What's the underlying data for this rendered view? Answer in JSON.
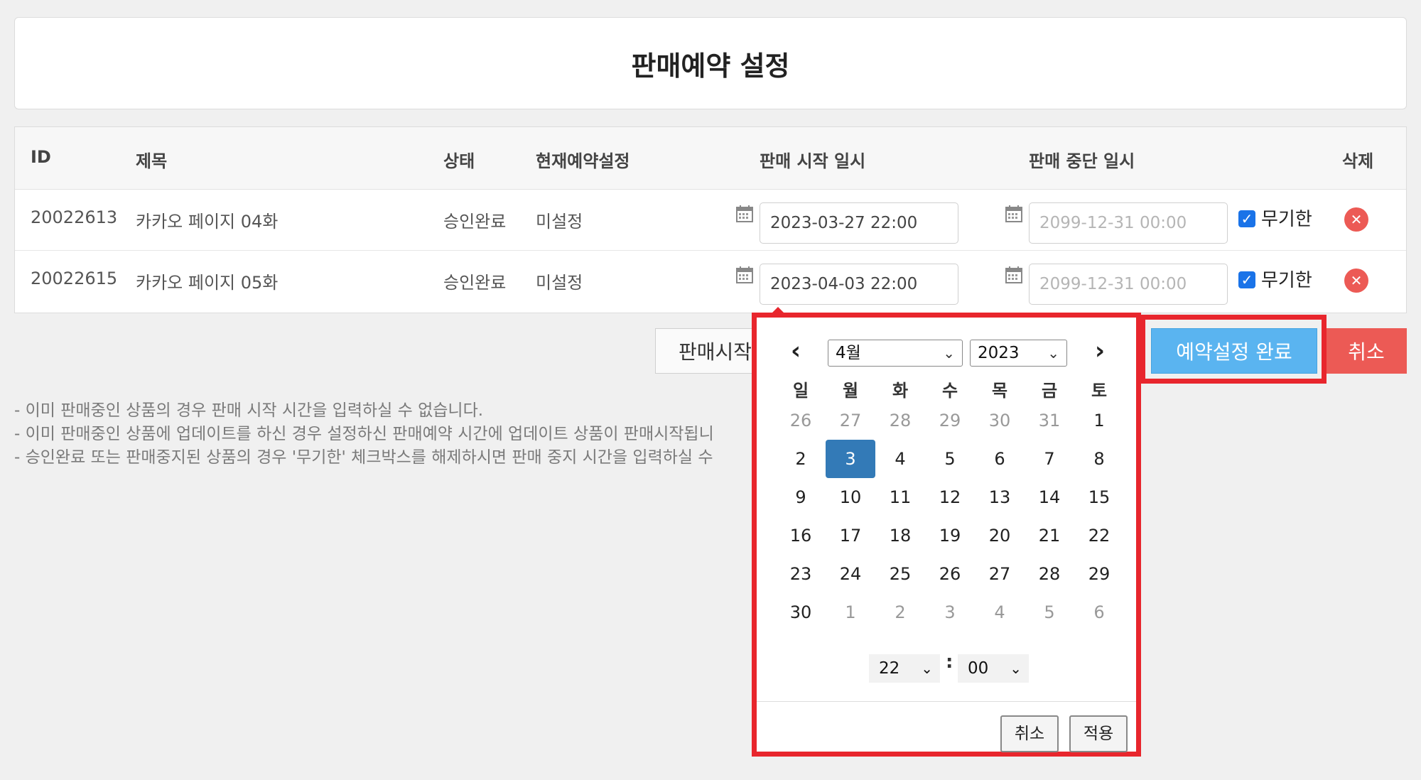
{
  "page": {
    "title": "판매예약 설정"
  },
  "table": {
    "headers": {
      "id": "ID",
      "title": "제목",
      "status": "상태",
      "current": "현재예약설정",
      "start": "판매 시작 일시",
      "stop": "판매 중단 일시",
      "delete": "삭제"
    },
    "rows": [
      {
        "id": "20022613",
        "title": "카카오 페이지 04화",
        "status": "승인완료",
        "current": "미설정",
        "start": "2023-03-27 22:00",
        "stop": "2099-12-31 00:00",
        "unlimited_label": "무기한",
        "unlimited_checked": true
      },
      {
        "id": "20022615",
        "title": "카카오 페이지 05화",
        "status": "승인완료",
        "current": "미설정",
        "start": "2023-04-03 22:00",
        "stop": "2099-12-31 00:00",
        "unlimited_label": "무기한",
        "unlimited_checked": true
      }
    ]
  },
  "buttons": {
    "start_sale": "판매시작",
    "complete": "예약설정 완료",
    "cancel": "취소"
  },
  "notes": [
    "- 이미 판매중인 상품의 경우 판매 시작 시간을 입력하실 수 없습니다.",
    "- 이미 판매중인 상품에 업데이트를 하신 경우 설정하신 판매예약 시간에 업데이트 상품이 판매시작됩니",
    "- 승인완료 또는 판매중지된 상품의 경우 '무기한' 체크박스를 해제하시면 판매 중지 시간을 입력하실 수"
  ],
  "datepicker": {
    "month": "4월",
    "year": "2023",
    "weekdays": [
      "일",
      "월",
      "화",
      "수",
      "목",
      "금",
      "토"
    ],
    "weeks": [
      [
        "26",
        "27",
        "28",
        "29",
        "30",
        "31",
        "1"
      ],
      [
        "2",
        "3",
        "4",
        "5",
        "6",
        "7",
        "8"
      ],
      [
        "9",
        "10",
        "11",
        "12",
        "13",
        "14",
        "15"
      ],
      [
        "16",
        "17",
        "18",
        "19",
        "20",
        "21",
        "22"
      ],
      [
        "23",
        "24",
        "25",
        "26",
        "27",
        "28",
        "29"
      ],
      [
        "30",
        "1",
        "2",
        "3",
        "4",
        "5",
        "6"
      ]
    ],
    "selected_day": "3",
    "hour": "22",
    "minute": "00",
    "colon": ":",
    "cancel_label": "취소",
    "apply_label": "적용"
  },
  "colors": {
    "accent": "#337ab7",
    "highlight": "#e8262d",
    "primary_button": "#5ab4f0",
    "danger": "#ec5a55"
  }
}
